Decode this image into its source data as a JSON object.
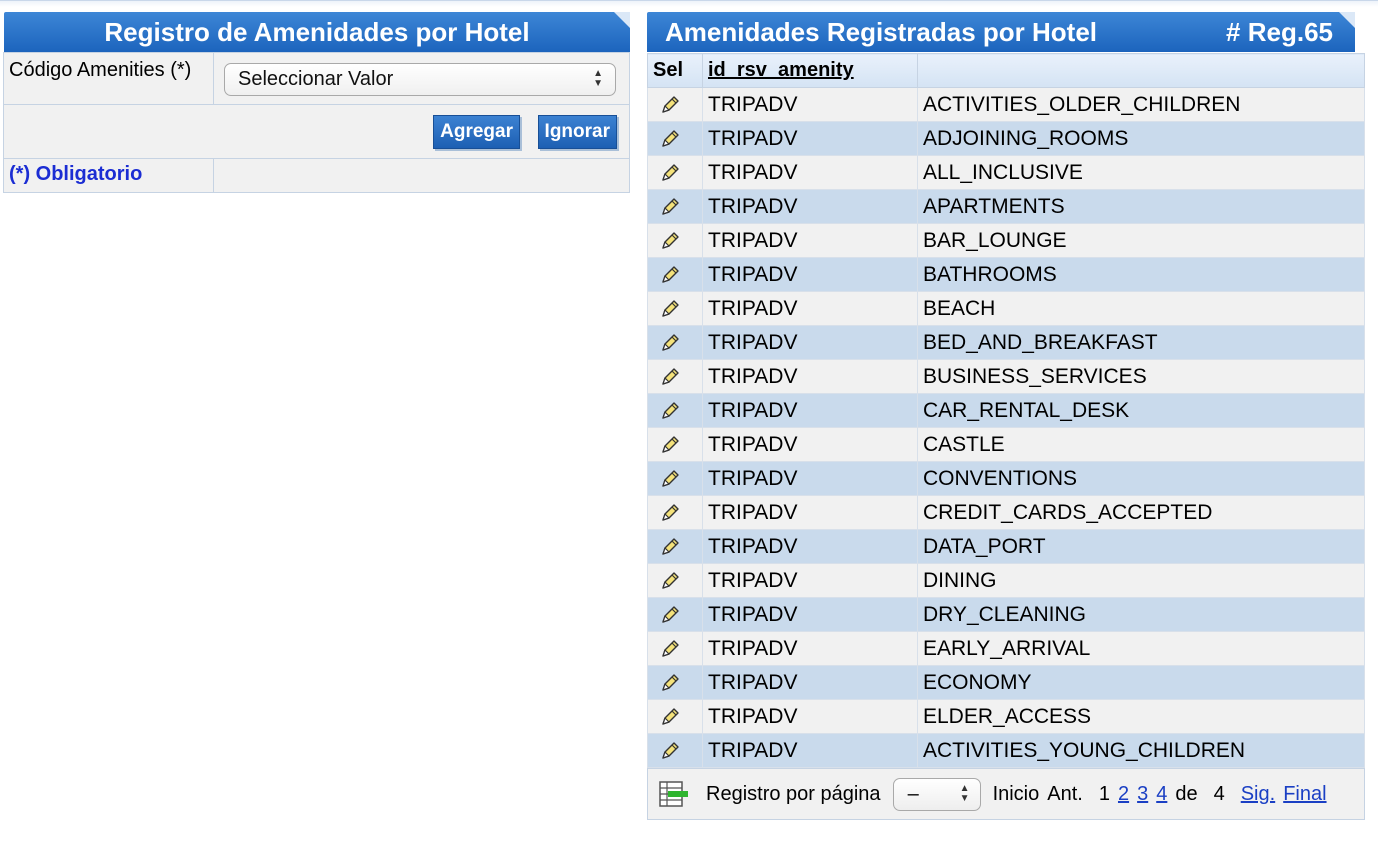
{
  "form_panel": {
    "title": "Registro de Amenidades por Hotel",
    "field_label": "Código Amenities (*)",
    "select_value": "Seleccionar Valor",
    "add_button": "Agregar",
    "ignore_button": "Ignorar",
    "required_note": "(*) Obligatorio"
  },
  "list_panel": {
    "title": "Amenidades Registradas por Hotel",
    "record_count": "# Reg.65",
    "columns": [
      "Sel",
      "id_rsv_amenity",
      ""
    ],
    "rows": [
      {
        "hotel": "TRIPADV",
        "amenity": "ACTIVITIES_OLDER_CHILDREN"
      },
      {
        "hotel": "TRIPADV",
        "amenity": "ADJOINING_ROOMS"
      },
      {
        "hotel": "TRIPADV",
        "amenity": "ALL_INCLUSIVE"
      },
      {
        "hotel": "TRIPADV",
        "amenity": "APARTMENTS"
      },
      {
        "hotel": "TRIPADV",
        "amenity": "BAR_LOUNGE"
      },
      {
        "hotel": "TRIPADV",
        "amenity": "BATHROOMS"
      },
      {
        "hotel": "TRIPADV",
        "amenity": "BEACH"
      },
      {
        "hotel": "TRIPADV",
        "amenity": "BED_AND_BREAKFAST"
      },
      {
        "hotel": "TRIPADV",
        "amenity": "BUSINESS_SERVICES"
      },
      {
        "hotel": "TRIPADV",
        "amenity": "CAR_RENTAL_DESK"
      },
      {
        "hotel": "TRIPADV",
        "amenity": "CASTLE"
      },
      {
        "hotel": "TRIPADV",
        "amenity": "CONVENTIONS"
      },
      {
        "hotel": "TRIPADV",
        "amenity": "CREDIT_CARDS_ACCEPTED"
      },
      {
        "hotel": "TRIPADV",
        "amenity": "DATA_PORT"
      },
      {
        "hotel": "TRIPADV",
        "amenity": "DINING"
      },
      {
        "hotel": "TRIPADV",
        "amenity": "DRY_CLEANING"
      },
      {
        "hotel": "TRIPADV",
        "amenity": "EARLY_ARRIVAL"
      },
      {
        "hotel": "TRIPADV",
        "amenity": "ECONOMY"
      },
      {
        "hotel": "TRIPADV",
        "amenity": "ELDER_ACCESS"
      },
      {
        "hotel": "TRIPADV",
        "amenity": "ACTIVITIES_YOUNG_CHILDREN"
      }
    ],
    "row_icon": "pencil-edit-icon",
    "pager": {
      "icon": "grid-settings-icon",
      "per_page_label": "Registro por página",
      "per_page_value": "–",
      "start_label": "Inicio",
      "prev_label": "Ant.",
      "current_page": "1",
      "page_links": [
        "2",
        "3",
        "4"
      ],
      "of_label": "de",
      "total_pages": "4",
      "next_label": "Sig.",
      "last_label": "Final"
    }
  },
  "colors": {
    "header_blue": "#1c64bd",
    "row_even": "#c9daec",
    "row_odd": "#f1f1f1",
    "link_blue": "#1a3fc4"
  }
}
